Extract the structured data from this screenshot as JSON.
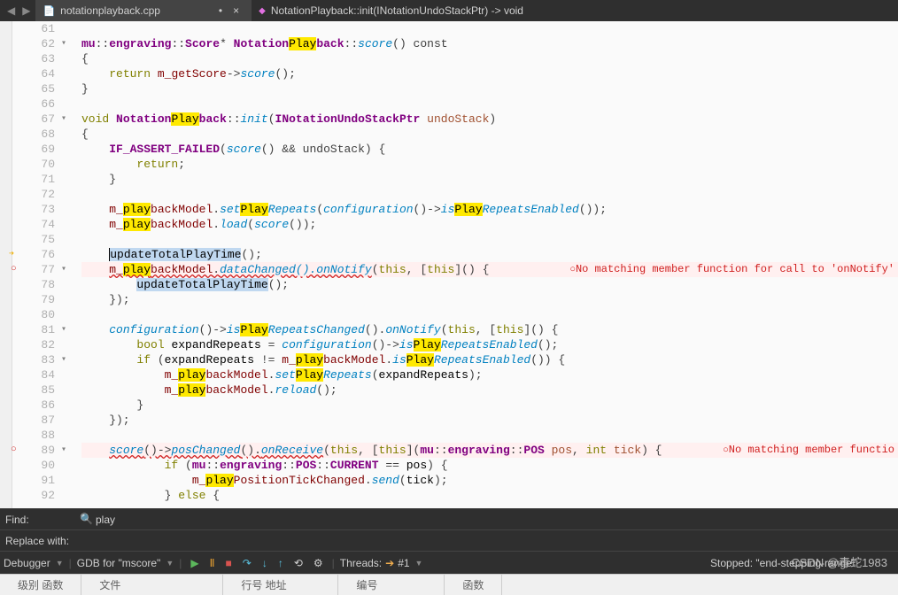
{
  "top": {
    "filename": "notationplayback.cpp",
    "modified_indicator": "•",
    "close": "×",
    "breadcrumb": "NotationPlayback::init(INotationUndoStackPtr) -> void"
  },
  "gutter": {
    "lines": [
      61,
      62,
      63,
      64,
      65,
      66,
      67,
      68,
      69,
      70,
      71,
      72,
      73,
      74,
      75,
      76,
      77,
      78,
      79,
      80,
      81,
      82,
      83,
      84,
      85,
      86,
      87,
      88,
      89,
      90,
      91,
      92
    ],
    "folds": {
      "62": true,
      "67": true,
      "77": true,
      "81": true,
      "83": true,
      "89": true
    },
    "arrow_line": 76,
    "breakpoints": [
      77,
      89
    ]
  },
  "code": {
    "61": "",
    "62": {
      "pre": "",
      "t1": "mu",
      "op1": "::",
      "t2": "engraving",
      "op2": "::",
      "t3": "Score",
      "op3": "* ",
      "t4": "Notation",
      "hl1": "Play",
      "t5": "back",
      "op4": "::",
      "f1": "score",
      "tail": "() const"
    },
    "63": "{",
    "64": {
      "indent": "    ",
      "kw": "return",
      "sp": " ",
      "m": "m_getScore",
      "arrow": "->",
      "f": "score",
      "tail": "();"
    },
    "65": "}",
    "66": "",
    "67": {
      "kw": "void",
      "sp": " ",
      "t1": "Notation",
      "hl": "Play",
      "t2": "back",
      "op": "::",
      "f": "init",
      "paren": "(",
      "type": "INotationUndoStackPtr",
      "sp2": " ",
      "p": "undoStack",
      "close": ")"
    },
    "68": "{",
    "69": {
      "indent": "    ",
      "macro": "IF_ASSERT_FAILED",
      "paren": "(",
      "f": "score",
      "mid": "() && undoStack) {"
    },
    "70": {
      "indent": "        ",
      "kw": "return",
      "semi": ";"
    },
    "71": "    }",
    "72": "",
    "73": {
      "indent": "    ",
      "m": "m_",
      "hl1": "play",
      "m2": "backModel",
      "dot": ".",
      "f": "set",
      "hl2": "Play",
      "f2": "Repeats",
      "paren": "(",
      "f3": "configuration",
      "mid": "()->",
      "f4": "is",
      "hl3": "Play",
      "f5": "RepeatsEnabled",
      "tail": "());"
    },
    "74": {
      "indent": "    ",
      "m": "m_",
      "hl": "play",
      "m2": "backModel",
      "dot": ".",
      "f": "load",
      "paren": "(",
      "f2": "score",
      "tail": "());"
    },
    "75": "",
    "76": {
      "indent": "    ",
      "sel_pre": "updateTotal",
      "sel_hl": "Play",
      "sel_post": "Time",
      "tail": "();"
    },
    "77": {
      "indent": "    ",
      "err": "m_",
      "err_hl": "play",
      "err2": "backModel",
      "err_dot": ".",
      "err3": "dataChanged().onNotify",
      "paren": "(",
      "kw": "this",
      "comma": ", [",
      "kw2": "this",
      "close": "]() {",
      "error_msg": "No matching member function for call to 'onNotify'"
    },
    "78": {
      "indent": "        ",
      "sel_pre": "updateTotal",
      "sel_hl": "Play",
      "sel_post": "Time",
      "tail": "();"
    },
    "79": "    });",
    "80": "",
    "81": {
      "indent": "    ",
      "f": "configuration",
      "mid": "()->",
      "f2": "is",
      "hl": "Play",
      "f3": "RepeatsChanged",
      "mid2": "().",
      "f4": "onNotify",
      "paren": "(",
      "kw": "this",
      "comma": ", [",
      "kw2": "this",
      "close": "]() {"
    },
    "82": {
      "indent": "        ",
      "kw": "bool",
      "sp": " ",
      "v": "expandRepeats",
      "eq": " = ",
      "f": "configuration",
      "mid": "()->",
      "f2": "is",
      "hl": "Play",
      "f3": "RepeatsEnabled",
      "tail": "();"
    },
    "83": {
      "indent": "        ",
      "kw": "if",
      "paren": " (",
      "v": "expandRepeats",
      "neq": " != ",
      "m": "m_",
      "hl": "play",
      "m2": "backModel",
      "dot": ".",
      "f": "is",
      "hl2": "Play",
      "f2": "RepeatsEnabled",
      "tail": "()) {"
    },
    "84": {
      "indent": "            ",
      "m": "m_",
      "hl": "play",
      "m2": "backModel",
      "dot": ".",
      "f": "set",
      "hl2": "Play",
      "f2": "Repeats",
      "paren": "(",
      "v": "expandRepeats",
      "tail": ");"
    },
    "85": {
      "indent": "            ",
      "m": "m_",
      "hl": "play",
      "m2": "backModel",
      "dot": ".",
      "f": "reload",
      "tail": "();"
    },
    "86": "        }",
    "87": "    });",
    "88": "",
    "89": {
      "indent": "    ",
      "err": "score",
      "err2": "()->",
      "err3": "posChanged",
      "err4": "().",
      "err5": "onReceive",
      "paren": "(",
      "kw": "this",
      "comma": ", [",
      "kw2": "this",
      "close": "](",
      "t1": "mu",
      "op1": "::",
      "t2": "engraving",
      "op2": "::",
      "t3": "POS",
      "sp": " ",
      "p": "pos",
      "comma2": ", ",
      "t4": "int",
      "sp2": " ",
      "p2": "tick",
      "close2": ") {",
      "error_msg": "No matching member functio"
    },
    "90": {
      "indent": "            ",
      "kw": "if",
      "paren": " (",
      "t1": "mu",
      "op1": "::",
      "t2": "engraving",
      "op2": "::",
      "t3": "POS",
      "op3": "::",
      "c": "CURRENT",
      "eq": " == ",
      "v": "pos",
      "tail": ") {"
    },
    "91": {
      "indent": "                ",
      "m": "m_",
      "hl": "play",
      "m2": "PositionTickChanged",
      "dot": ".",
      "f": "send",
      "paren": "(",
      "v": "tick",
      "tail": ");"
    },
    "92": {
      "indent": "            ",
      "close": "} ",
      "kw": "else",
      "brace": " {"
    }
  },
  "find": {
    "find_label": "Find:",
    "find_value": "play",
    "replace_label": "Replace with:"
  },
  "bottom": {
    "debugger": "Debugger",
    "gdb": "GDB for \"mscore\"",
    "threads_label": "Threads:",
    "thread_value": "#1",
    "stopped": "Stopped: \"end-stepping-range\""
  },
  "tabs": {
    "t1": "级别  函数",
    "t2": "文件",
    "t3": "行号 地址",
    "t4": "编号",
    "t5": "函数"
  },
  "watermark": "CSDN @毒蛇1983"
}
